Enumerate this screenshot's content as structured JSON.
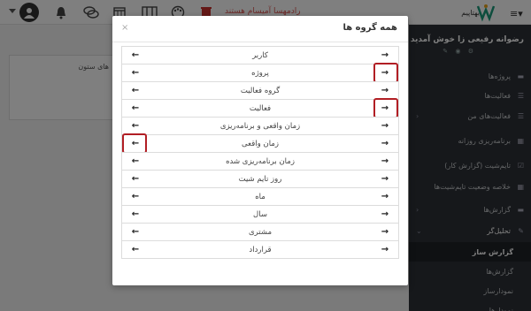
{
  "topbar": {
    "red_label": "رادمهسا آمیسام هستند",
    "brand_text": "بهتاپیم",
    "icons": [
      "user-avatar-icon",
      "bell-icon",
      "chat-icon",
      "calendar-icon",
      "columns-icon",
      "palette-icon",
      "trash-icon",
      "menu-icon"
    ]
  },
  "content": {
    "column_label": "های ستون"
  },
  "sidebar": {
    "user_name": "رضوانه رفیعی زا خوش آمدید",
    "items": [
      {
        "label": "پروژه‌ها",
        "icon": "folder-icon"
      },
      {
        "label": "فعالیت‌ها",
        "icon": "list-icon"
      },
      {
        "label": "فعالیت‌های من",
        "icon": "list-icon"
      },
      {
        "label": "برنامه‌ریزی روزانه",
        "icon": "table-icon"
      },
      {
        "label": "تایم‌شیت (گزارش کار)",
        "icon": "check-calendar-icon"
      },
      {
        "label": "خلاصه وضعیت تایم‌شیت‌ها",
        "icon": "table-icon"
      },
      {
        "label": "گزارش‌ها",
        "icon": "folder-icon"
      },
      {
        "label": "تحلیل‌گر",
        "icon": "wrench-icon"
      },
      {
        "label": "گزارش ساز",
        "icon": ""
      },
      {
        "label": "گزارش‌ها",
        "icon": ""
      },
      {
        "label": "نمودارساز",
        "icon": ""
      },
      {
        "label": "نمودارها",
        "icon": ""
      }
    ]
  },
  "modal": {
    "title": "همه گروه ها",
    "close": "×",
    "rows": [
      {
        "label": "کاربر"
      },
      {
        "label": "پروژه"
      },
      {
        "label": "گروه فعالیت"
      },
      {
        "label": "فعالیت"
      },
      {
        "label": "زمان واقعی و برنامه‌ریزی"
      },
      {
        "label": "زمان واقعی"
      },
      {
        "label": "زمان برنامه‌ریزی شده"
      },
      {
        "label": "روز تایم شیت"
      },
      {
        "label": "ماه"
      },
      {
        "label": "سال"
      },
      {
        "label": "مشتری"
      },
      {
        "label": "قرارداد"
      }
    ],
    "arrow_left": "←",
    "arrow_right": "→",
    "highlight_color": "#b11e24"
  }
}
